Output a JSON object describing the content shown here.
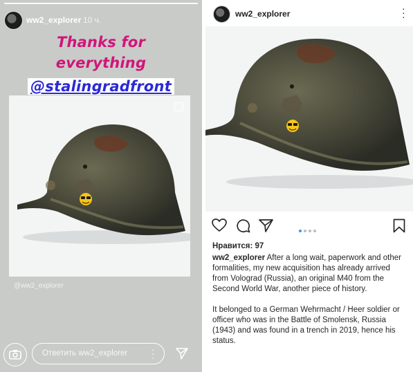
{
  "story": {
    "username": "ww2_explorer",
    "time": "10 ч.",
    "sticker_line1": "Thanks for",
    "sticker_line2": "everything",
    "mention": "@stalingradfront",
    "card_caption": "@ww2_explorer",
    "reply_placeholder": "Ответить ww2_explorer",
    "icons": [
      "camera-icon",
      "more-dots-icon",
      "send-icon",
      "carousel-square-icon"
    ],
    "colors": {
      "sticker_text": "#d1157a",
      "mention_text": "#2a29d6"
    }
  },
  "post": {
    "username": "ww2_explorer",
    "likes": "Нравится: 97",
    "caption_user": "ww2_explorer",
    "caption_p1": "After a long wait, paperwork and other formalities, my new acquisition has already arrived from Volograd (Russia), an original M40 from the Second World War, another piece of history.",
    "caption_p2": "It belonged to a German Wehrmacht / Heer soldier or officer who was in the Battle of Smolensk, Russia (1943) and was found in a trench in 2019, hence his status.",
    "carousel": {
      "count": 4,
      "active": 1
    },
    "icons": [
      "heart-icon",
      "comment-icon",
      "share-icon",
      "bookmark-icon",
      "more-vert-icon"
    ],
    "colors": {
      "active_dot": "#3897f0"
    }
  }
}
